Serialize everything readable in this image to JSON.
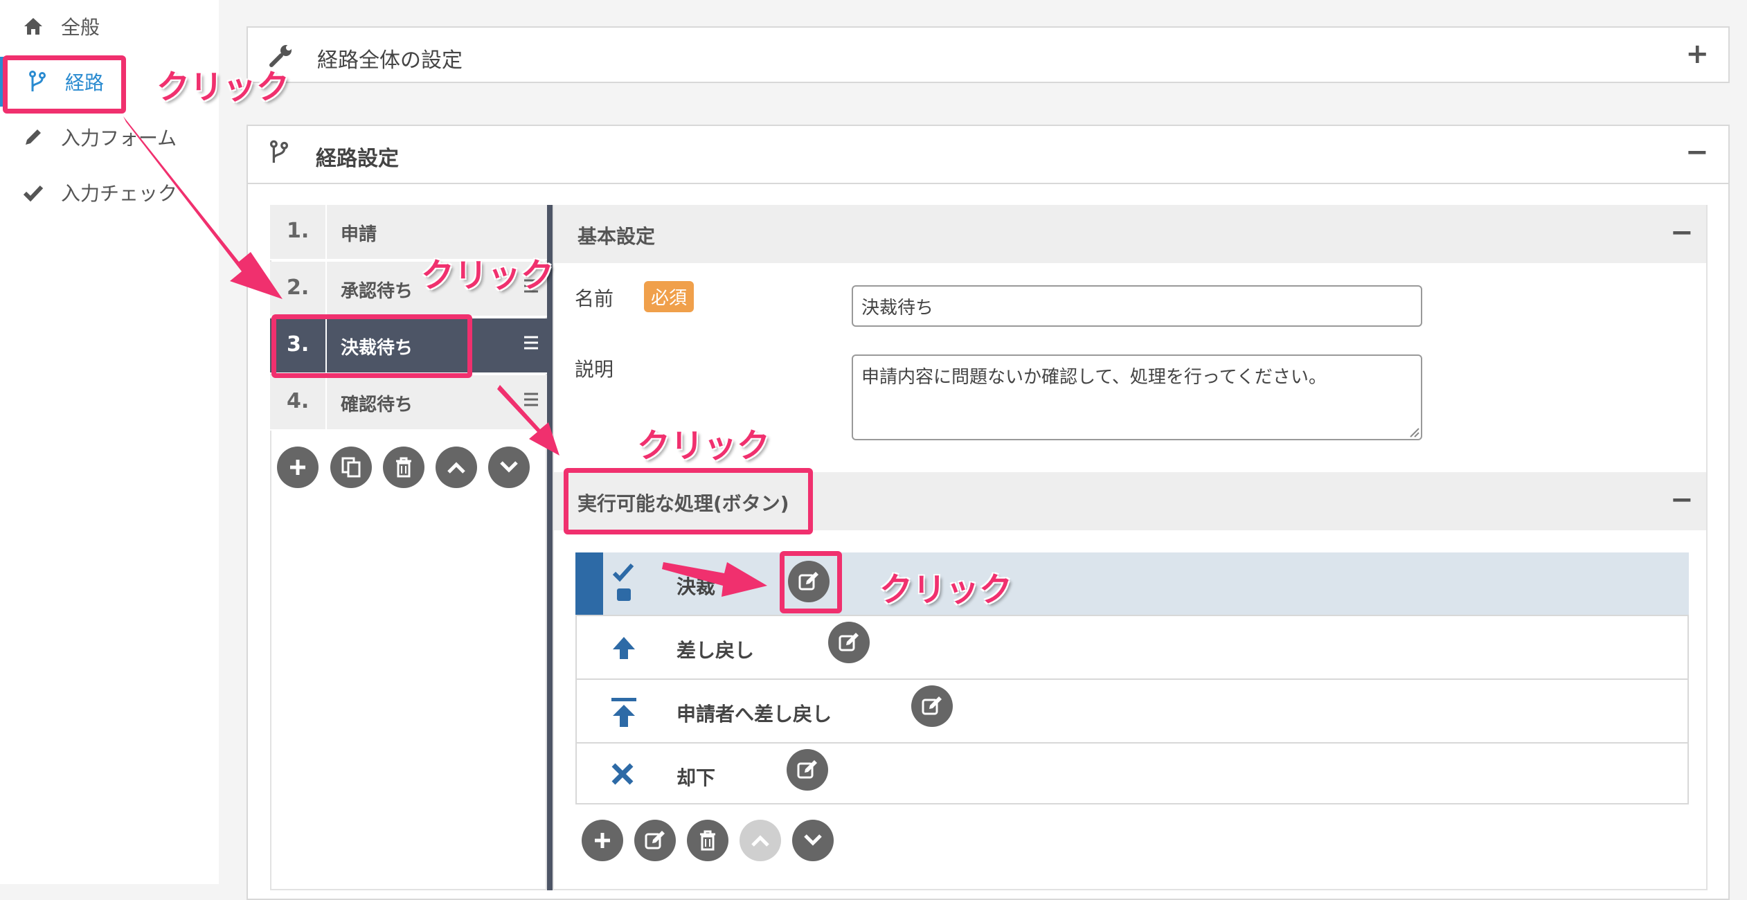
{
  "sidebar": {
    "items": [
      {
        "label": "全般",
        "icon": "home-icon"
      },
      {
        "label": "経路",
        "icon": "branch-icon"
      },
      {
        "label": "入力フォーム",
        "icon": "pencil-icon"
      },
      {
        "label": "入力チェック",
        "icon": "check-icon"
      }
    ],
    "accent": "#2a8bd0"
  },
  "route_overall": {
    "title": "経路全体の設定",
    "toggle": "+"
  },
  "route_settings": {
    "title": "経路設定",
    "toggle": "−",
    "steps": [
      {
        "num": "1.",
        "name": "申請"
      },
      {
        "num": "2.",
        "name": "承認待ち"
      },
      {
        "num": "3.",
        "name": "決裁待ち"
      },
      {
        "num": "4.",
        "name": "確認待ち"
      }
    ]
  },
  "basic": {
    "title": "基本設定",
    "toggle": "−",
    "name_label": "名前",
    "required_badge": "必須",
    "name_value": "決裁待ち",
    "desc_label": "説明",
    "desc_value": "申請内容に問題ないか確認して、処理を行ってください。"
  },
  "actions": {
    "title": "実行可能な処理(ボタン)",
    "toggle": "−",
    "items": [
      {
        "name": "決裁",
        "icon": "approve-icon"
      },
      {
        "name": "差し戻し",
        "icon": "arrow-up-icon"
      },
      {
        "name": "申請者へ差し戻し",
        "icon": "arrow-up-bar-icon"
      },
      {
        "name": "却下",
        "icon": "x-icon"
      }
    ]
  },
  "annotations": {
    "click": "クリック",
    "color": "#f0306e"
  }
}
